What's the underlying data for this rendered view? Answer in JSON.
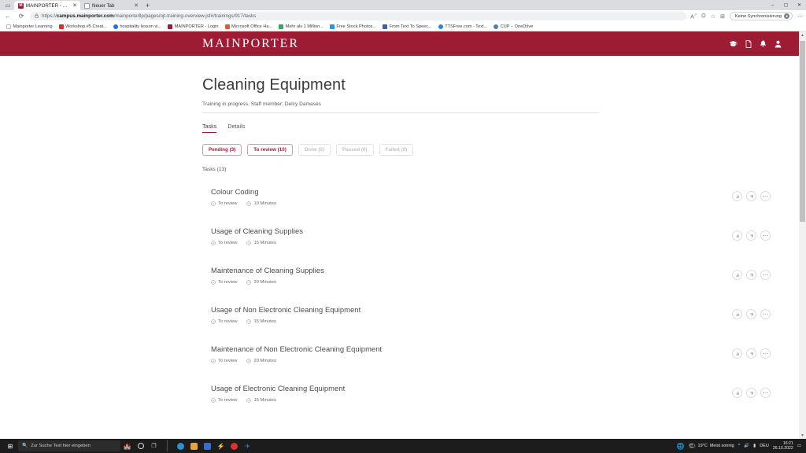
{
  "browser": {
    "tabs": [
      {
        "title": "MAINPORTER - On-the-job trai",
        "favicon": "mainporter-icon",
        "active": true
      },
      {
        "title": "Neuer Tab",
        "favicon": "blank-page-icon",
        "active": false
      }
    ],
    "new_tab_label": "+",
    "window_controls": [
      "–",
      "▢",
      "✕"
    ],
    "nav": {
      "back": "←",
      "forward": "→",
      "reload": "⟳"
    },
    "address": {
      "lock": "🔒",
      "url_prefix": "https://",
      "url_domain": "campus.mainporter.com",
      "url_path": "/mainporterllp/pages/ojt-training-overview.jsf#/trainings/917/tasks"
    },
    "toolbar_icons": [
      "read-aloud-icon",
      "collections-icon",
      "favorites-icon",
      "browser-essentials-icon"
    ],
    "profile": {
      "label": "Keine Synchronisierung"
    },
    "more_label": "⋯",
    "bookmarks": [
      {
        "label": "Mainporter Learning",
        "color": "#ffffff"
      },
      {
        "label": "Workshop #5 Creat...",
        "color": "#e02d28"
      },
      {
        "label": "hospitality lesson vi...",
        "color": "#1a73e8"
      },
      {
        "label": "MAINPORTER - Login",
        "color": "#a31834"
      },
      {
        "label": "Microsoft Office Ha...",
        "color": "#e8562b"
      },
      {
        "label": "Mehr als 1 Million...",
        "color": "#34a853"
      },
      {
        "label": "Free Stock Photos...",
        "color": "#2196f3"
      },
      {
        "label": "From Text To Speec...",
        "color": "#3b5fa8"
      },
      {
        "label": "TTSFree.com - Text...",
        "color": "#1e88e5"
      },
      {
        "label": "CUP – OneDrive",
        "color": "#4a7fb5"
      }
    ]
  },
  "app": {
    "brand": "MAINPORTER",
    "brand_color": "#9e1b34",
    "header_icons": [
      {
        "name": "graduation-cap-icon"
      },
      {
        "name": "document-icon"
      },
      {
        "name": "bell-icon"
      },
      {
        "name": "user-icon"
      }
    ]
  },
  "main": {
    "title": "Cleaning Equipment",
    "subtitle": "Training in progress. Staff member: Delcy Damases",
    "tabs": [
      {
        "label": "Tasks",
        "active": true
      },
      {
        "label": "Details",
        "active": false
      }
    ],
    "filters": [
      {
        "label": "Pending (3)",
        "state": "active"
      },
      {
        "label": "To review (10)",
        "state": "active"
      },
      {
        "label": "Done (0)",
        "state": "disabled"
      },
      {
        "label": "Passed (0)",
        "state": "disabled"
      },
      {
        "label": "Failed (0)",
        "state": "disabled"
      }
    ],
    "tasks_count_label": "Tasks (13)",
    "tasks": [
      {
        "title": "Colour Coding",
        "status": "To review",
        "duration": "10 Minutes"
      },
      {
        "title": "Usage of Cleaning Supplies",
        "status": "To review",
        "duration": "15 Minutes"
      },
      {
        "title": "Maintenance of Cleaning Supplies",
        "status": "To review",
        "duration": "20 Minutes"
      },
      {
        "title": "Usage of Non Electronic Cleaning Equipment",
        "status": "To review",
        "duration": "15 Minutes"
      },
      {
        "title": "Maintenance of Non Electronic Cleaning Equipment",
        "status": "To review",
        "duration": "20 Minutes"
      },
      {
        "title": "Usage of Electronic Cleaning Equipment",
        "status": "To review",
        "duration": "15 Minutes"
      }
    ],
    "row_actions": [
      {
        "name": "thumbs-up-button"
      },
      {
        "name": "thumbs-down-button"
      },
      {
        "name": "more-options-button"
      }
    ]
  },
  "taskbar": {
    "search_placeholder": "Zur Suche Text hier eingeben",
    "apps": [
      {
        "name": "cortana-icon",
        "color": "#d8d8d8"
      },
      {
        "name": "task-view-icon",
        "color": "#d8d8d8"
      },
      {
        "name": "edge-icon",
        "color": "#2b8fd0"
      },
      {
        "name": "file-explorer-icon",
        "color": "#e8a33d"
      },
      {
        "name": "dropbox-icon",
        "color": "#2f6fd8"
      },
      {
        "name": "lightning-icon",
        "color": "#2f8fe0"
      },
      {
        "name": "opera-icon",
        "color": "#e03131"
      },
      {
        "name": "rocket-icon",
        "color": "#4a80d0"
      }
    ],
    "weather_temp": "19°C",
    "weather_desc": "Meist sonnig",
    "lang": "DEU",
    "time": "16:21",
    "date": "26.10.2022"
  }
}
